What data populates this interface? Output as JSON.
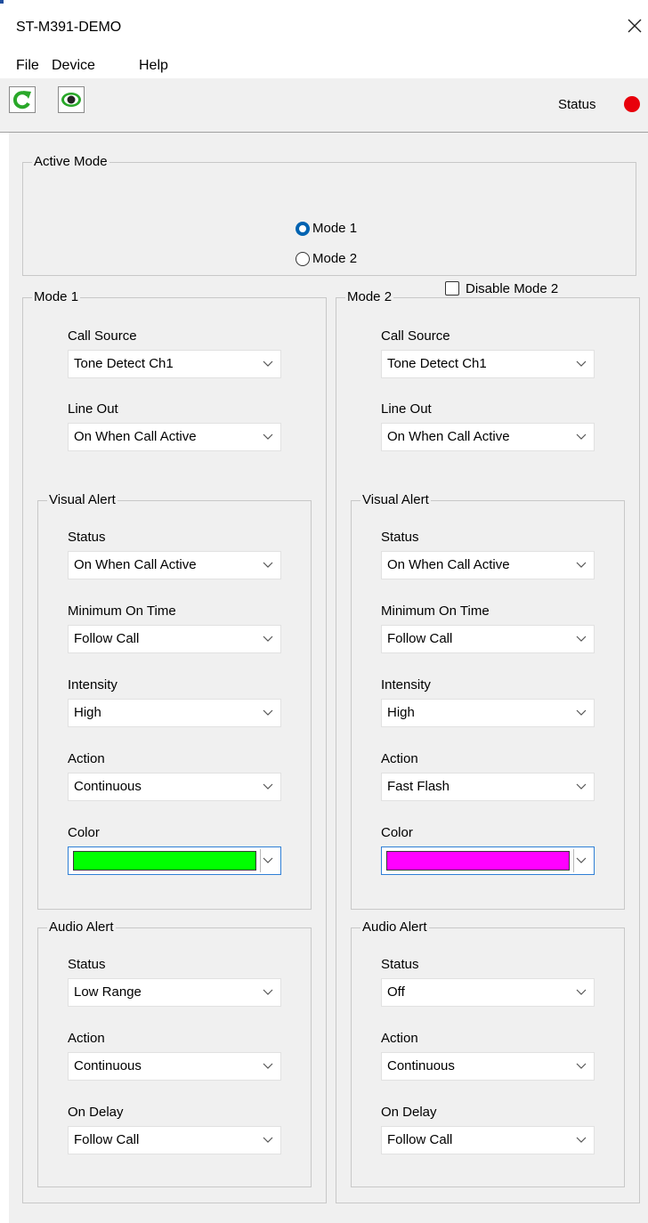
{
  "window": {
    "title": "ST-M391-DEMO"
  },
  "menu": {
    "items": [
      "File",
      "Device",
      "Help"
    ]
  },
  "toolbar": {
    "refresh_icon": "refresh-icon",
    "view_icon": "eye-icon",
    "accent_color": "#2aa82a"
  },
  "status": {
    "label": "Status",
    "indicator_color": "#e8000b"
  },
  "active_mode": {
    "legend": "Active Mode",
    "options": [
      "Mode 1",
      "Mode 2"
    ],
    "selected": "Mode 1",
    "disable_mode2_label": "Disable Mode 2",
    "disable_mode2_checked": false
  },
  "mode1": {
    "legend": "Mode 1",
    "call_source": {
      "label": "Call Source",
      "value": "Tone Detect Ch1"
    },
    "line_out": {
      "label": "Line Out",
      "value": "On When Call Active"
    },
    "visual": {
      "legend": "Visual Alert",
      "status": {
        "label": "Status",
        "value": "On When Call Active"
      },
      "min_on_time": {
        "label": "Minimum On Time",
        "value": "Follow Call"
      },
      "intensity": {
        "label": "Intensity",
        "value": "High"
      },
      "action": {
        "label": "Action",
        "value": "Continuous"
      },
      "color": {
        "label": "Color",
        "value": "#00ff00"
      }
    },
    "audio": {
      "legend": "Audio Alert",
      "status": {
        "label": "Status",
        "value": "Low Range"
      },
      "action": {
        "label": "Action",
        "value": "Continuous"
      },
      "on_delay": {
        "label": "On Delay",
        "value": "Follow Call"
      }
    }
  },
  "mode2": {
    "legend": "Mode 2",
    "call_source": {
      "label": "Call Source",
      "value": "Tone Detect Ch1"
    },
    "line_out": {
      "label": "Line Out",
      "value": "On When Call Active"
    },
    "visual": {
      "legend": "Visual Alert",
      "status": {
        "label": "Status",
        "value": "On When Call Active"
      },
      "min_on_time": {
        "label": "Minimum On Time",
        "value": "Follow Call"
      },
      "intensity": {
        "label": "Intensity",
        "value": "High"
      },
      "action": {
        "label": "Action",
        "value": "Fast Flash"
      },
      "color": {
        "label": "Color",
        "value": "#ff00ff"
      }
    },
    "audio": {
      "legend": "Audio Alert",
      "status": {
        "label": "Status",
        "value": "Off"
      },
      "action": {
        "label": "Action",
        "value": "Continuous"
      },
      "on_delay": {
        "label": "On Delay",
        "value": "Follow Call"
      }
    }
  }
}
